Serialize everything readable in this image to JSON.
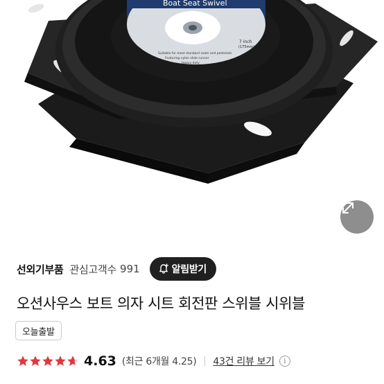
{
  "product_image": {
    "label_text": "Boat Seat Swivel",
    "size_text": "7 inch",
    "size_metric": "(175mm)",
    "caption_lines": [
      "Suitable for most standard seats and pedestals",
      "Featuring nylon slide runner",
      "Heavy duty"
    ]
  },
  "seller": {
    "name": "선외기부품",
    "follower_label": "관심고객수",
    "follower_count": "991",
    "alert_button_label": "알림받기"
  },
  "product": {
    "title": "오션사우스 보트 의자 시트 회전판 스위블 시위블",
    "badge": "오늘출발"
  },
  "rating": {
    "stars_value": 4.63,
    "score": "4.63",
    "recent_text": "(최근 6개월 4.25)",
    "review_link": "43건 리뷰 보기",
    "info_symbol": "i",
    "star_color": "#e0383e"
  },
  "icons": {
    "expand": "expand-arrows-icon",
    "bell": "bell-plus-icon",
    "star": "star-icon",
    "info": "info-icon"
  }
}
